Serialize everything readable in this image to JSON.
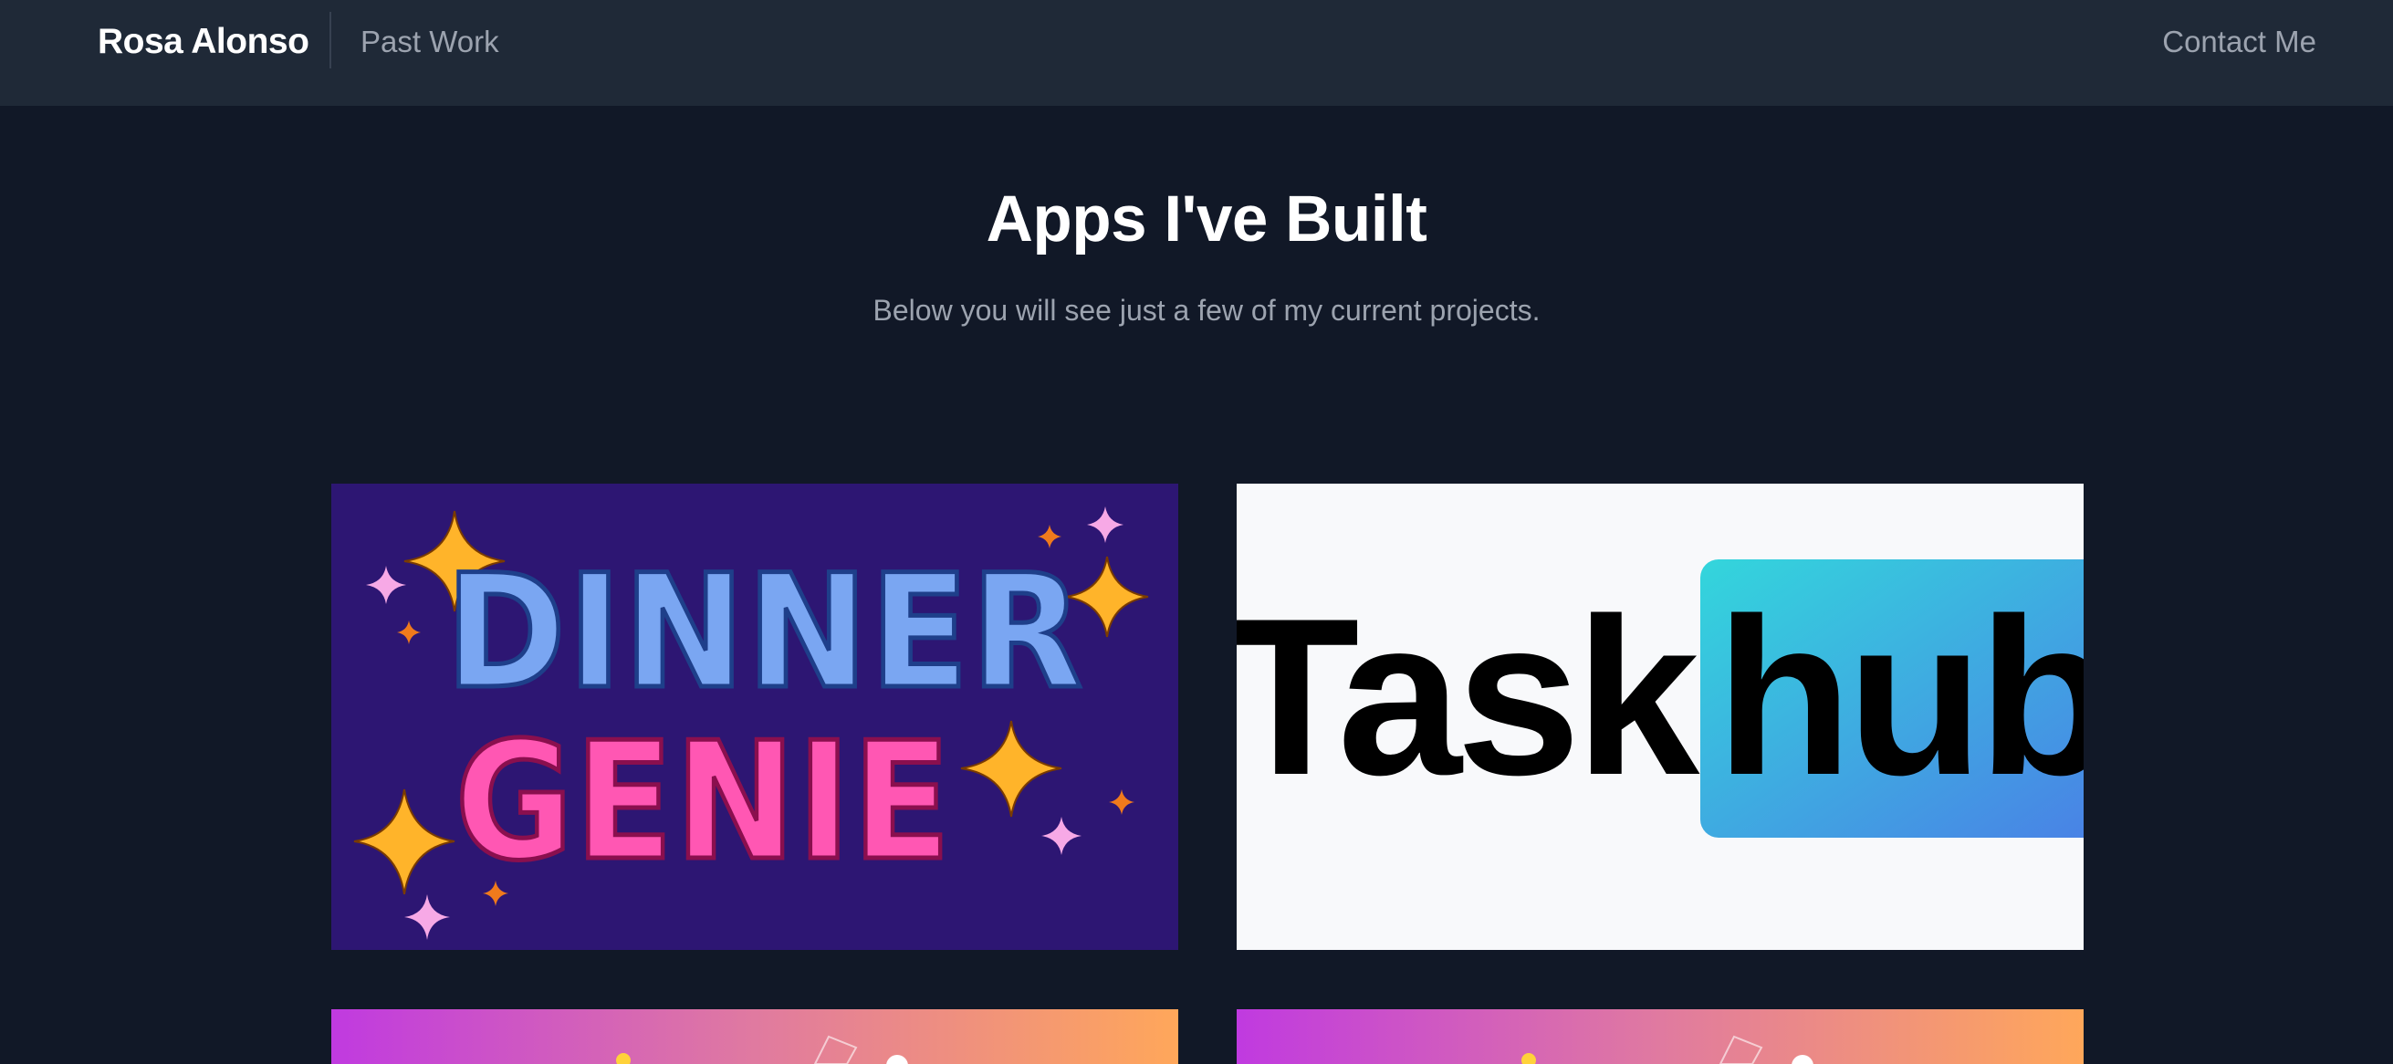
{
  "nav": {
    "brand": "Rosa Alonso",
    "past_work": "Past Work",
    "contact": "Contact Me"
  },
  "hero": {
    "title": "Apps I've Built",
    "subtitle": "Below you will see just a few of my current projects."
  },
  "projects": [
    {
      "logo_line1": "DINNER",
      "logo_line2": "GENIE",
      "colors": {
        "background": "#2d1673",
        "line1": "#7aa6f2",
        "line2": "#ff57b3",
        "sparkle": "#ffb42a",
        "accent": "#f07a1c",
        "pink": "#f7a9e6"
      }
    },
    {
      "logo_word": "Task",
      "logo_badge": "hub",
      "colors": {
        "background": "#f8f9fb",
        "text": "#000000",
        "badge_from": "#33d6dc",
        "badge_to": "#4a7fe6"
      }
    },
    {
      "colors": {
        "gradient_from": "#c03ae0",
        "gradient_to": "#ffa75a"
      }
    },
    {
      "colors": {
        "gradient_from": "#c03ae0",
        "gradient_to": "#ffa75a"
      }
    }
  ]
}
